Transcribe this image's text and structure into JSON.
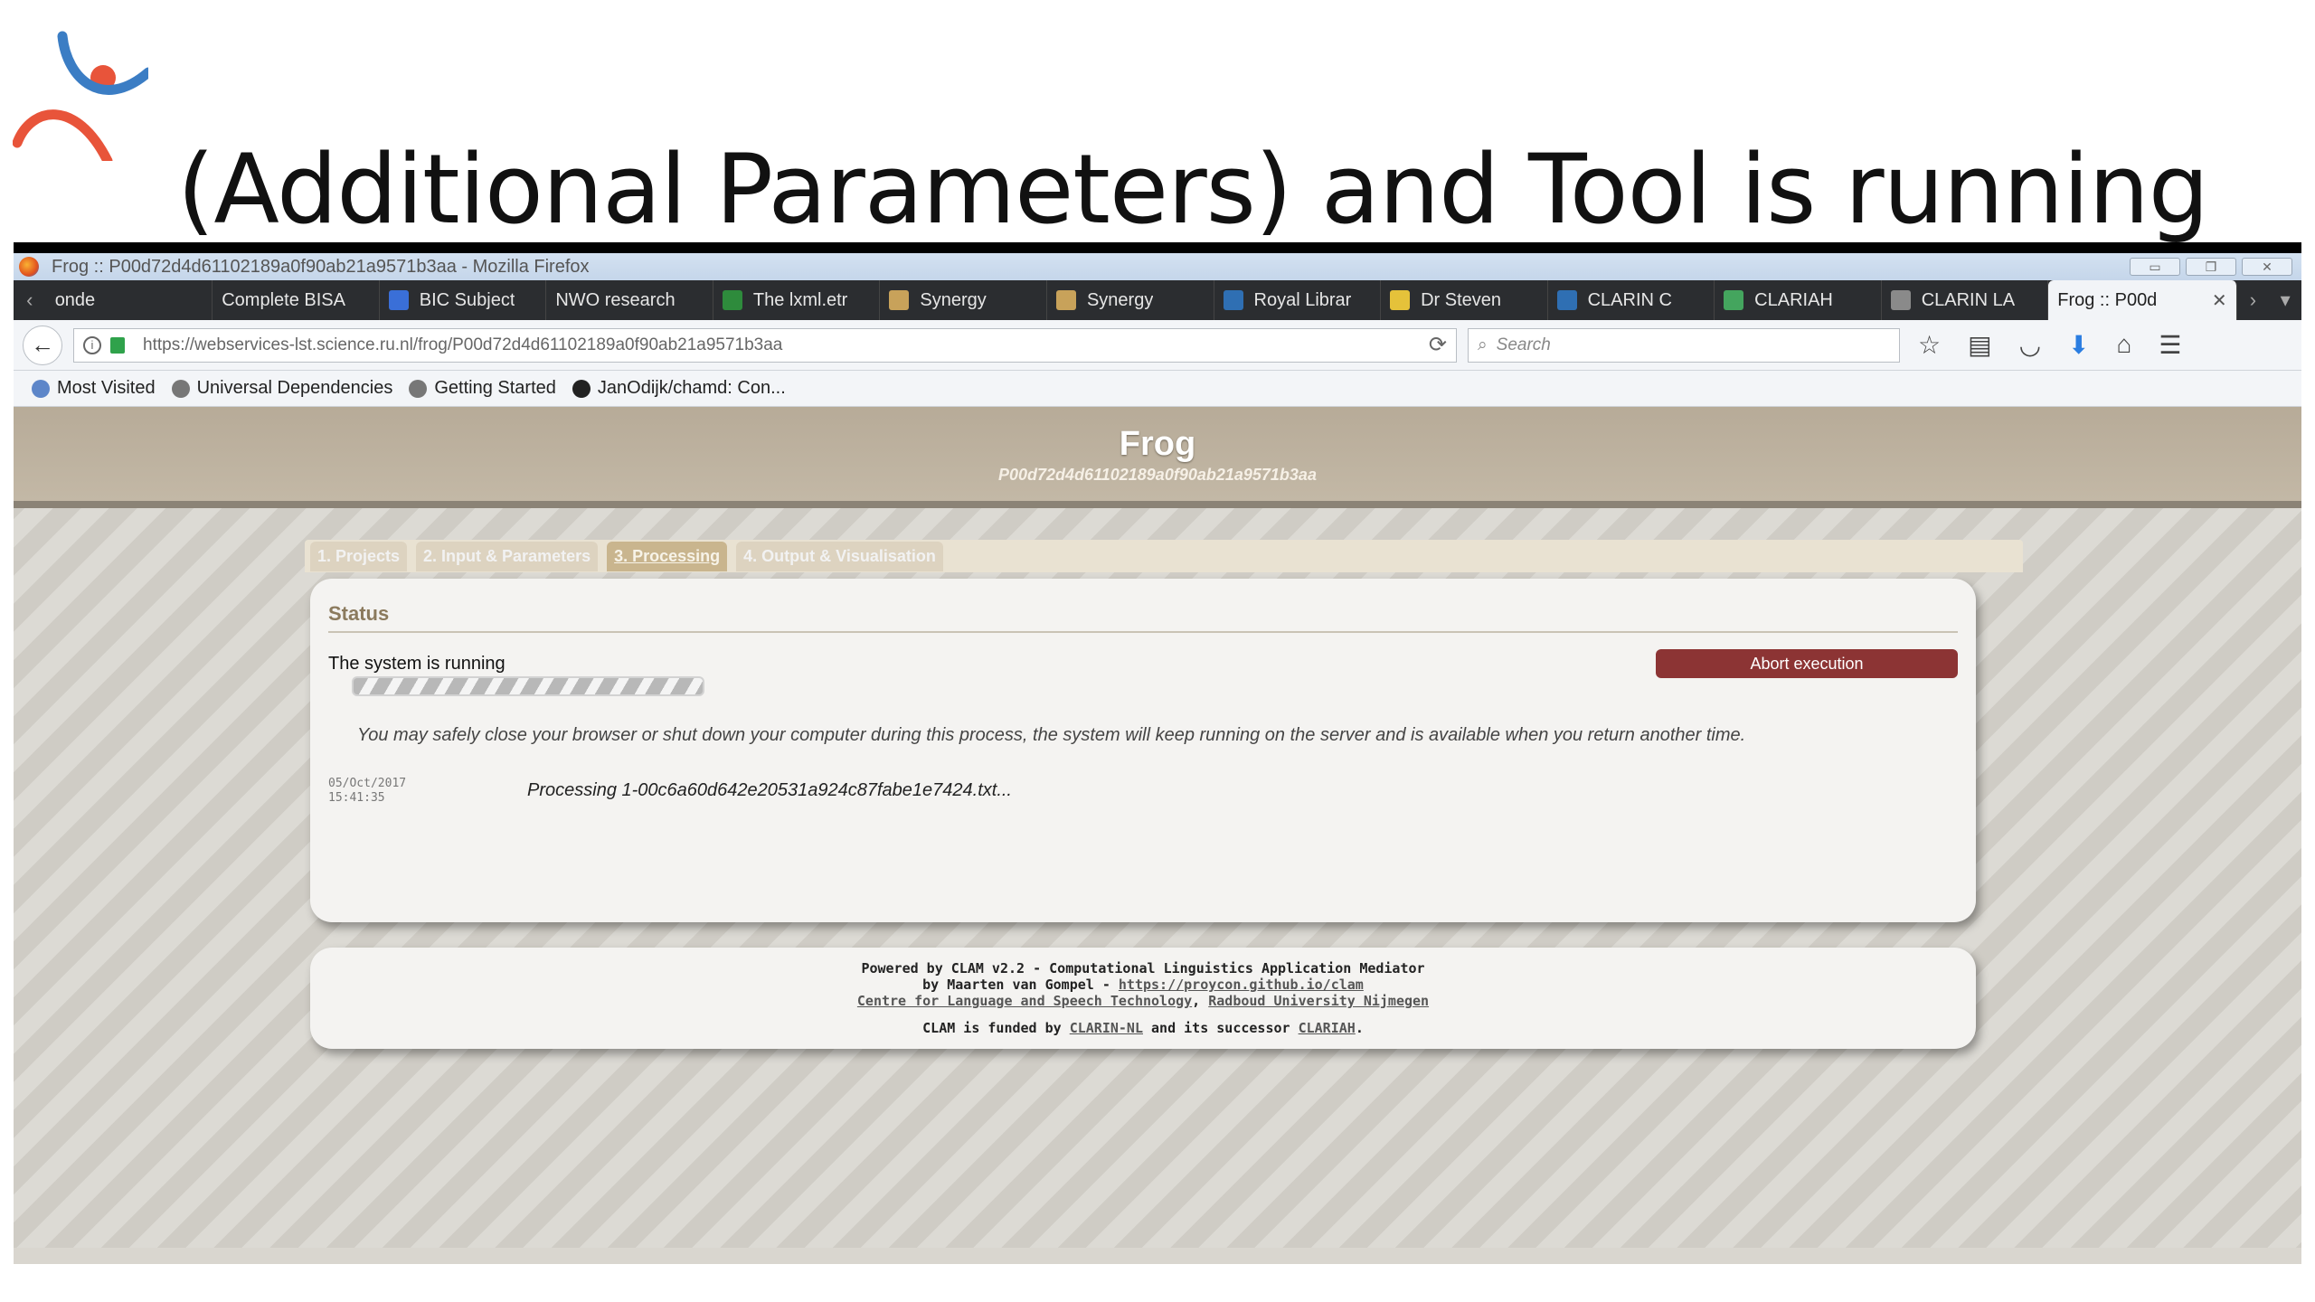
{
  "slide": {
    "title": "(Additional Parameters)  and Tool is running"
  },
  "browser": {
    "window_title": "Frog :: P00d72d4d61102189a0f90ab21a9571b3aa - Mozilla Firefox",
    "tabs": [
      {
        "label": "onde",
        "color": "#666666"
      },
      {
        "label": "Complete BISA",
        "color": "#666666"
      },
      {
        "label": "BIC Subject",
        "color": "#3a6fd8"
      },
      {
        "label": "NWO research",
        "color": "#666666"
      },
      {
        "label": "The lxml.etr",
        "color": "#2e8b3c"
      },
      {
        "label": "Synergy",
        "color": "#c8a25a"
      },
      {
        "label": "Synergy",
        "color": "#c8a25a"
      },
      {
        "label": "Royal Librar",
        "color": "#2f6fb3"
      },
      {
        "label": "Dr Steven",
        "color": "#e5c23a"
      },
      {
        "label": "CLARIN C",
        "color": "#2f6fb3"
      },
      {
        "label": "CLARIAH",
        "color": "#44a55e"
      },
      {
        "label": "CLARIN LA",
        "color": "#8a8a8a"
      }
    ],
    "active_tab": "Frog :: P00d",
    "url": "https://webservices-lst.science.ru.nl/frog/P00d72d4d61102189a0f90ab21a9571b3aa",
    "search_placeholder": "Search",
    "bookmarks": [
      "Most Visited",
      "Universal Dependencies",
      "Getting Started",
      "JanOdijk/chamd: Con..."
    ]
  },
  "page": {
    "title": "Frog",
    "project_id": "P00d72d4d61102189a0f90ab21a9571b3aa",
    "steps": [
      "1. Projects",
      "2. Input & Parameters",
      "3. Processing",
      "4. Output & Visualisation"
    ],
    "status": {
      "heading": "Status",
      "running_text": "The system is running",
      "abort_label": "Abort execution",
      "safe_message": "You may safely close your browser or shut down your computer during this process, the system will keep running on the server and is available when you return another time.",
      "log_date": "05/Oct/2017",
      "log_time": "15:41:35",
      "log_message": "Processing 1-00c6a60d642e20531a924c87fabe1e7424.txt..."
    },
    "footer": {
      "line1": "Powered by CLAM v2.2 - Computational Linguistics Application Mediator",
      "line2_prefix": "by Maarten van Gompel - ",
      "line2_link": "https://proycon.github.io/clam",
      "line3_link1": "Centre for Language and Speech Technology",
      "line3_sep": ", ",
      "line3_link2": "Radboud University Nijmegen",
      "funded_prefix": "CLAM is funded by ",
      "funded_link1": "CLARIN-NL",
      "funded_mid": " and its successor ",
      "funded_link2": "CLARIAH",
      "funded_suffix": "."
    }
  },
  "colors": {
    "abort_button": "#8c3434",
    "header_band": "#b7ab98",
    "status_heading": "#8b7a5d"
  }
}
